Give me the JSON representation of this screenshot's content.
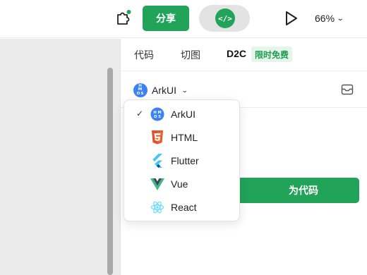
{
  "toolbar": {
    "share_label": "分享",
    "dev_mode_icon": "</>",
    "zoom_label": "66%",
    "icons": [
      "puzzle-plugin-icon",
      "play-icon",
      "chevron-down-icon"
    ],
    "accent_color": "#21a35a",
    "notification_dot_color": "#21a35a"
  },
  "panel": {
    "tabs": [
      {
        "label": "代码"
      },
      {
        "label": "切图"
      },
      {
        "label": "D2C",
        "active": true
      }
    ],
    "free_badge": "限时免费",
    "framework": {
      "selected": "ArkUI",
      "logo_text": "HMOS"
    },
    "convert_button": "为代码"
  },
  "dropdown": {
    "options": [
      {
        "label": "ArkUI",
        "icon": "hmos-logo-icon",
        "selected": true,
        "check": "✓"
      },
      {
        "label": "HTML",
        "icon": "html5-icon"
      },
      {
        "label": "Flutter",
        "icon": "flutter-icon"
      },
      {
        "label": "Vue",
        "icon": "vue-icon"
      },
      {
        "label": "React",
        "icon": "react-icon"
      }
    ]
  },
  "colors": {
    "accent": "#21a35a",
    "canvas_bg": "#ebebeb",
    "html5": "#e44d26",
    "flutter": "#47c5fb",
    "vue_green": "#41b883",
    "vue_dark": "#34495e",
    "react": "#61dafb",
    "hmos": "#3b82f6"
  }
}
